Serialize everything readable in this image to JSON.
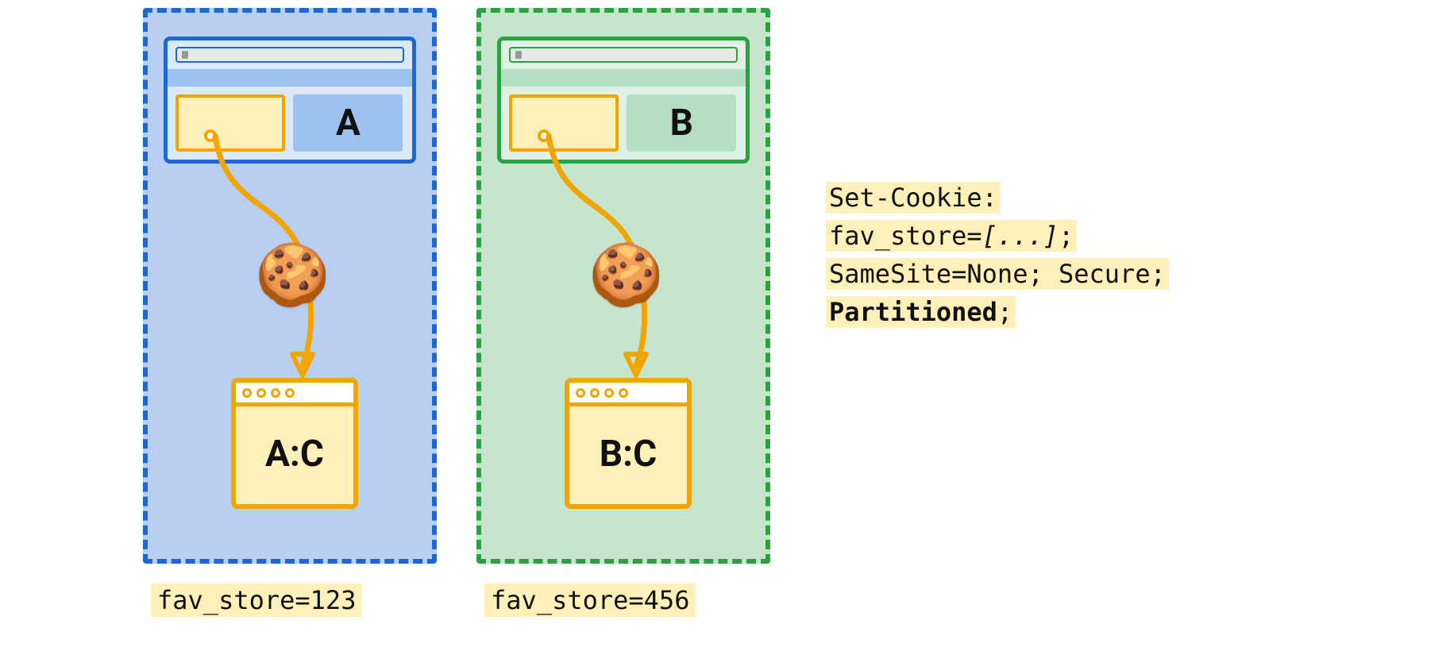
{
  "partitions": {
    "A": {
      "main_label": "A",
      "jar_label": "A:C",
      "caption": "fav_store=123"
    },
    "B": {
      "main_label": "B",
      "jar_label": "B:C",
      "caption": "fav_store=456"
    }
  },
  "code": {
    "line1_a": "Set-Cookie:",
    "line2_a": "fav_store=",
    "line2_b": "[...]",
    "line2_c": ";",
    "line3_a": "SameSite=None; Secure;",
    "line4_a": "Partitioned",
    "line4_b": ";"
  },
  "icons": {
    "cookie": "🍪"
  }
}
